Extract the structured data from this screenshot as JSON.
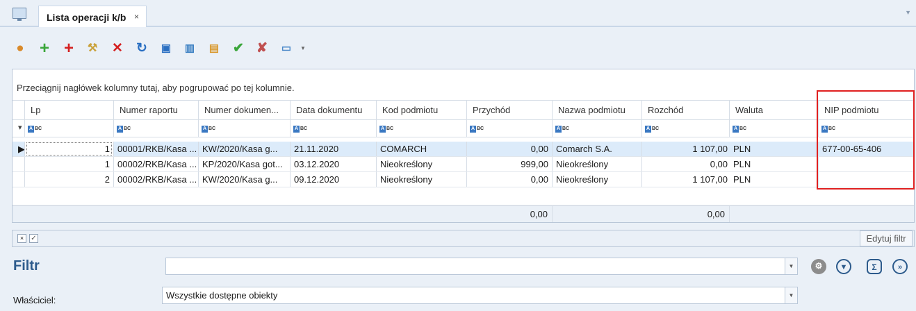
{
  "tab": {
    "title": "Lista operacji k/b",
    "close": "×"
  },
  "group_hint": "Przeciągnij nagłówek kolumny tutaj, aby pogrupować po tej kolumnie.",
  "columns": [
    "Lp",
    "Numer raportu",
    "Numer dokumen...",
    "Data dokumentu",
    "Kod podmiotu",
    "Przychód",
    "Nazwa podmiotu",
    "Rozchód",
    "Waluta",
    "NIP podmiotu"
  ],
  "rows": [
    {
      "lp": "1",
      "raport": "00001/RKB/Kasa ...",
      "dokument": "KW/2020/Kasa g...",
      "data": "21.11.2020",
      "kod": "COMARCH",
      "przychod": "0,00",
      "nazwa": "Comarch S.A.",
      "rozchod": "1 107,00",
      "waluta": "PLN",
      "nip": "677-00-65-406"
    },
    {
      "lp": "1",
      "raport": "00002/RKB/Kasa ...",
      "dokument": "KP/2020/Kasa got...",
      "data": "03.12.2020",
      "kod": "Nieokreślony",
      "przychod": "999,00",
      "nazwa": "Nieokreślony",
      "rozchod": "0,00",
      "waluta": "PLN",
      "nip": ""
    },
    {
      "lp": "2",
      "raport": "00002/RKB/Kasa ...",
      "dokument": "KW/2020/Kasa g...",
      "data": "09.12.2020",
      "kod": "Nieokreślony",
      "przychod": "0,00",
      "nazwa": "Nieokreślony",
      "rozchod": "1 107,00",
      "waluta": "PLN",
      "nip": ""
    }
  ],
  "totals": {
    "przychod": "0,00",
    "rozchod": "0,00"
  },
  "filter_bar": {
    "clear": "×",
    "check": "✓",
    "edit_button": "Edytuj filtr"
  },
  "filter": {
    "label": "Filtr",
    "value": ""
  },
  "owner": {
    "label": "Właściciel:",
    "value": "Wszystkie dostępne obiekty"
  },
  "toolbar_icons": [
    "user-icon",
    "add-icon",
    "add-red-icon",
    "wrench-icon",
    "delete-icon",
    "refresh-icon",
    "export-icon",
    "chart-icon",
    "document-icon",
    "approve-icon",
    "unapprove-icon",
    "view-icon"
  ],
  "colors": {
    "accent": "#2d5b8c",
    "highlight": "#e02020",
    "selected_row": "#dcebfa"
  }
}
